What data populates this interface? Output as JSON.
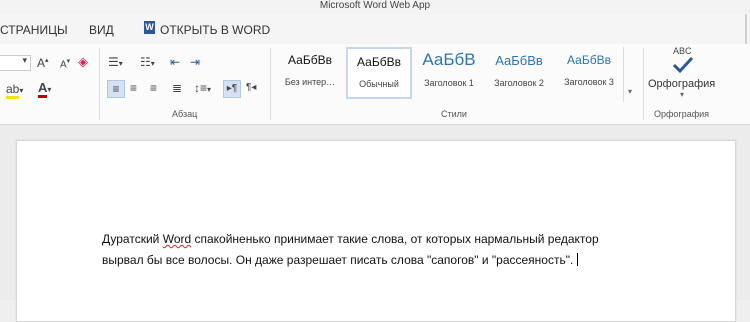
{
  "window": {
    "title": "Microsoft Word Web App"
  },
  "menubar": {
    "items": [
      "СТРАНИЦЫ",
      "ВИД"
    ],
    "open_in_word": "ОТКРЫТЬ В WORD",
    "word_logo": "W"
  },
  "ribbon": {
    "paragraph_group_label": "Абзац",
    "styles_group_label": "Стили",
    "spelling_group_label": "Орфография",
    "styles": [
      {
        "sample": "АаБбВв",
        "name": "Без интер…",
        "selected": false
      },
      {
        "sample": "АаБбВв",
        "name": "Обычный",
        "selected": true
      },
      {
        "sample": "АаБбВ",
        "name": "Заголовок 1",
        "selected": false
      },
      {
        "sample": "АаБбВв",
        "name": "Заголовок 2",
        "selected": false
      },
      {
        "sample": "АаБбВв",
        "name": "Заголовок 3",
        "selected": false
      }
    ],
    "spelling": {
      "abc": "ABC",
      "label": "Орфография"
    },
    "colors": {
      "accent": "#2b5797",
      "style_heading": "#2e74b5",
      "selected_border": "#c5d6ee"
    }
  },
  "document": {
    "text_before": "Дуратский ",
    "misspelled_word": "Word",
    "text_after": " спакойненько принимает такие слова, от которых нармальный редактор вырвал бы все волосы. Он даже разрешает писать слова \"сапогов\" и \"рассеяность\"."
  }
}
